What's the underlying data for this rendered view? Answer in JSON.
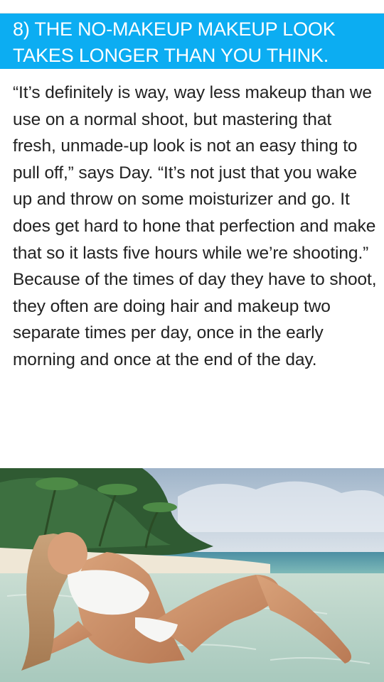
{
  "article": {
    "heading": "8) THE NO-MAKEUP MAKEUP LOOK TAKES LONGER THAN YOU THINK.",
    "body": "“It’s definitely is way, way less makeup than we use on a normal shoot, but mastering that fresh, unmade-up look is not an easy thing to pull off,” says Day. “It’s not just that you wake up and throw on some moisturizer and go. It does get hard to hone that perfection and make that so it lasts five hours while we’re shooting.” Because of the times of day they have to shoot, they often are doing hair and makeup two separate times per day, once in the early morning and once at the end of the day.",
    "accent_color": "#0cadf2"
  }
}
